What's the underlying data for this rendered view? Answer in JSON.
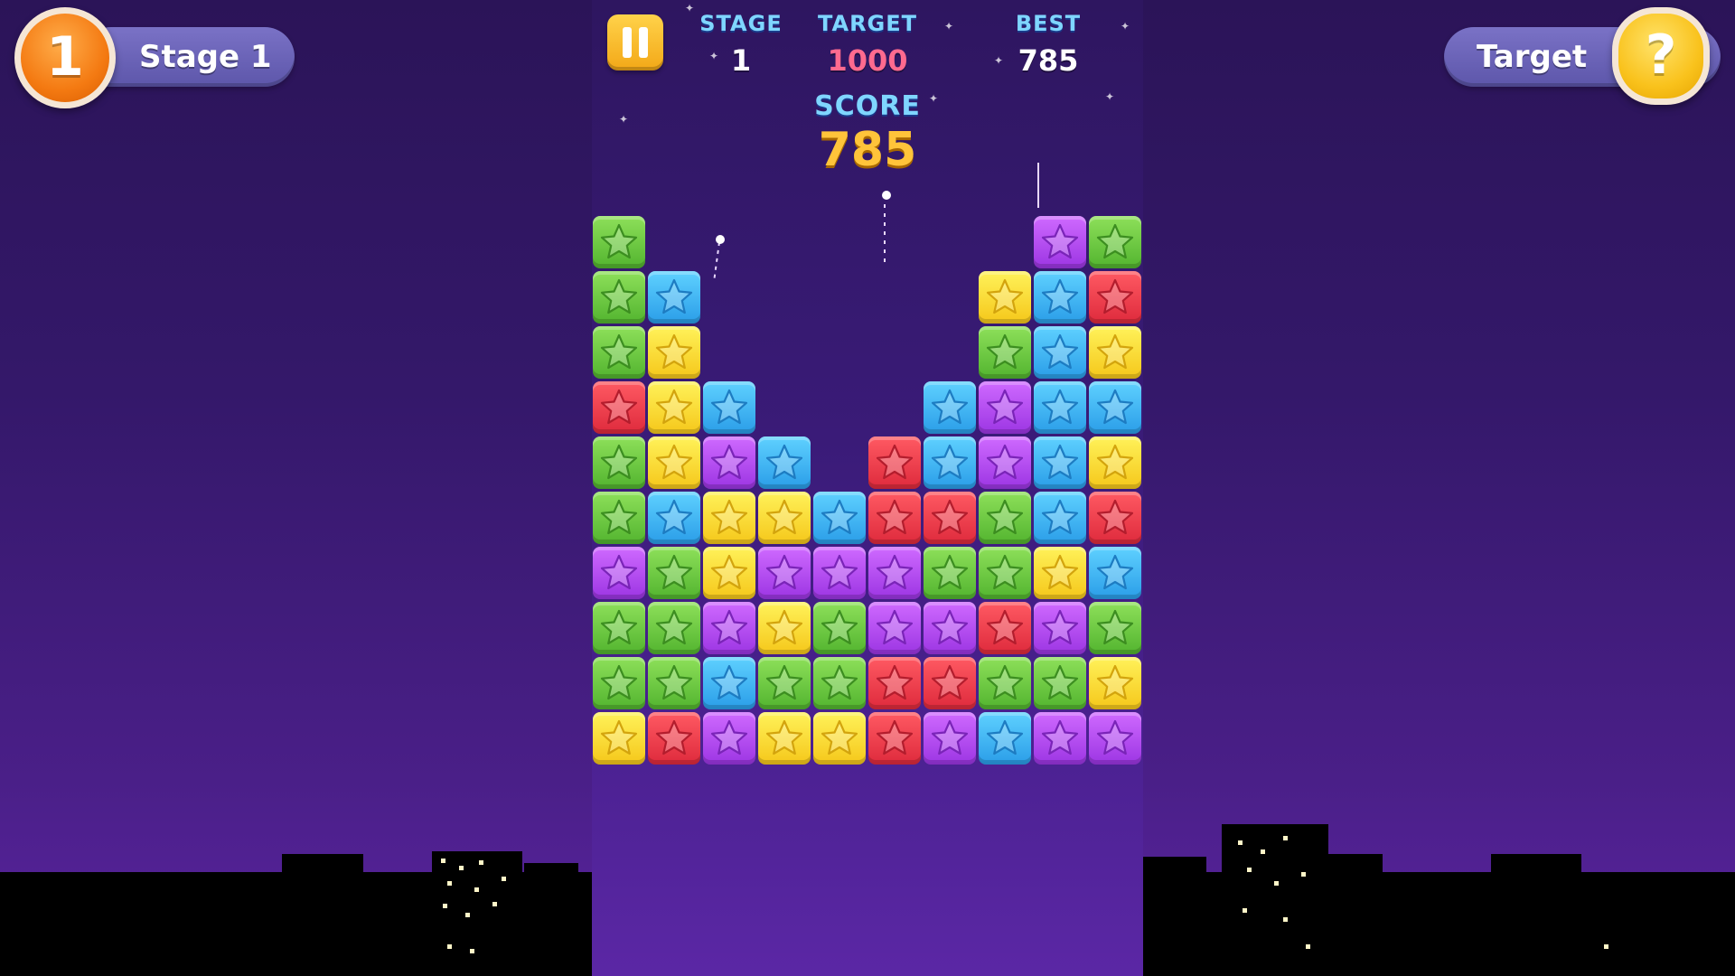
{
  "header": {
    "level_badge": "1",
    "stage_pill_label": "Stage 1",
    "target_pill_label": "Target",
    "help_badge": "?"
  },
  "stats": {
    "stage_label": "STAGE",
    "stage_value": "1",
    "target_label": "TARGET",
    "target_value": "1000",
    "best_label": "BEST",
    "best_value": "785",
    "score_label": "SCORE",
    "score_value": "785"
  },
  "colors": {
    "background": "#34186a",
    "green": "#52b42f",
    "blue": "#2a9de8",
    "yellow": "#f5c71a",
    "red": "#de2a3c",
    "purple": "#9c35e3",
    "score_text": "#ffc43a",
    "target_text": "#ff6a8f"
  },
  "icons": {
    "tile": "star-icon",
    "pause": "pause-icon",
    "help": "question-mark-icon"
  },
  "board": {
    "rows": 10,
    "cols": 10,
    "grid": [
      [
        "green",
        "",
        "",
        "",
        "",
        "",
        "",
        "",
        "purple",
        "green"
      ],
      [
        "green",
        "blue",
        "",
        "",
        "",
        "",
        "",
        "yellow",
        "blue",
        "red"
      ],
      [
        "green",
        "yellow",
        "",
        "",
        "",
        "",
        "",
        "green",
        "blue",
        "yellow"
      ],
      [
        "red",
        "yellow",
        "blue",
        "",
        "",
        "",
        "blue",
        "purple",
        "blue",
        "blue"
      ],
      [
        "green",
        "yellow",
        "purple",
        "blue",
        "",
        "red",
        "blue",
        "purple",
        "blue",
        "yellow"
      ],
      [
        "green",
        "blue",
        "yellow",
        "yellow",
        "blue",
        "red",
        "red",
        "green",
        "blue",
        "red"
      ],
      [
        "purple",
        "green",
        "yellow",
        "purple",
        "purple",
        "purple",
        "green",
        "green",
        "yellow",
        "blue"
      ],
      [
        "green",
        "green",
        "purple",
        "yellow",
        "green",
        "purple",
        "purple",
        "red",
        "purple",
        "green"
      ],
      [
        "green",
        "green",
        "blue",
        "green",
        "green",
        "red",
        "red",
        "green",
        "green",
        "yellow"
      ],
      [
        "yellow",
        "red",
        "purple",
        "yellow",
        "yellow",
        "red",
        "purple",
        "blue",
        "purple",
        "purple"
      ]
    ]
  }
}
